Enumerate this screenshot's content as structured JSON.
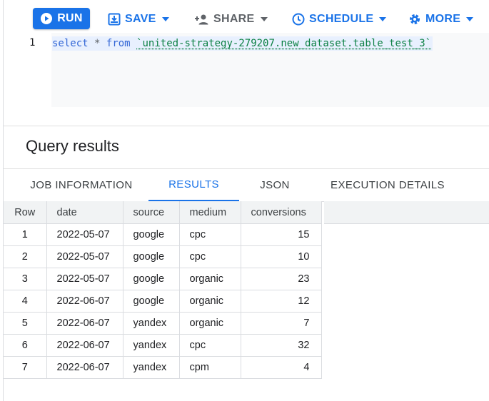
{
  "toolbar": {
    "run_label": "RUN",
    "save_label": "SAVE",
    "share_label": "SHARE",
    "schedule_label": "SCHEDULE",
    "more_label": "MORE"
  },
  "editor": {
    "line_number": "1",
    "kw_select": "select",
    "op_star": "*",
    "kw_from": "from",
    "table_ref": "`united-strategy-279207.new_dataset.table_test_3`"
  },
  "results": {
    "title": "Query results",
    "tabs": [
      "JOB INFORMATION",
      "RESULTS",
      "JSON",
      "EXECUTION DETAILS"
    ],
    "active_tab": "RESULTS",
    "columns": [
      "Row",
      "date",
      "source",
      "medium",
      "conversions"
    ],
    "rows": [
      [
        "1",
        "2022-05-07",
        "google",
        "cpc",
        "15"
      ],
      [
        "2",
        "2022-05-07",
        "google",
        "cpc",
        "10"
      ],
      [
        "3",
        "2022-05-07",
        "google",
        "organic",
        "23"
      ],
      [
        "4",
        "2022-06-07",
        "google",
        "organic",
        "12"
      ],
      [
        "5",
        "2022-06-07",
        "yandex",
        "organic",
        "7"
      ],
      [
        "6",
        "2022-06-07",
        "yandex",
        "cpc",
        "32"
      ],
      [
        "7",
        "2022-06-07",
        "yandex",
        "cpm",
        "4"
      ]
    ]
  },
  "colors": {
    "accent": "#1a73e8",
    "keyword": "#3367d6",
    "string": "#0b8043"
  }
}
